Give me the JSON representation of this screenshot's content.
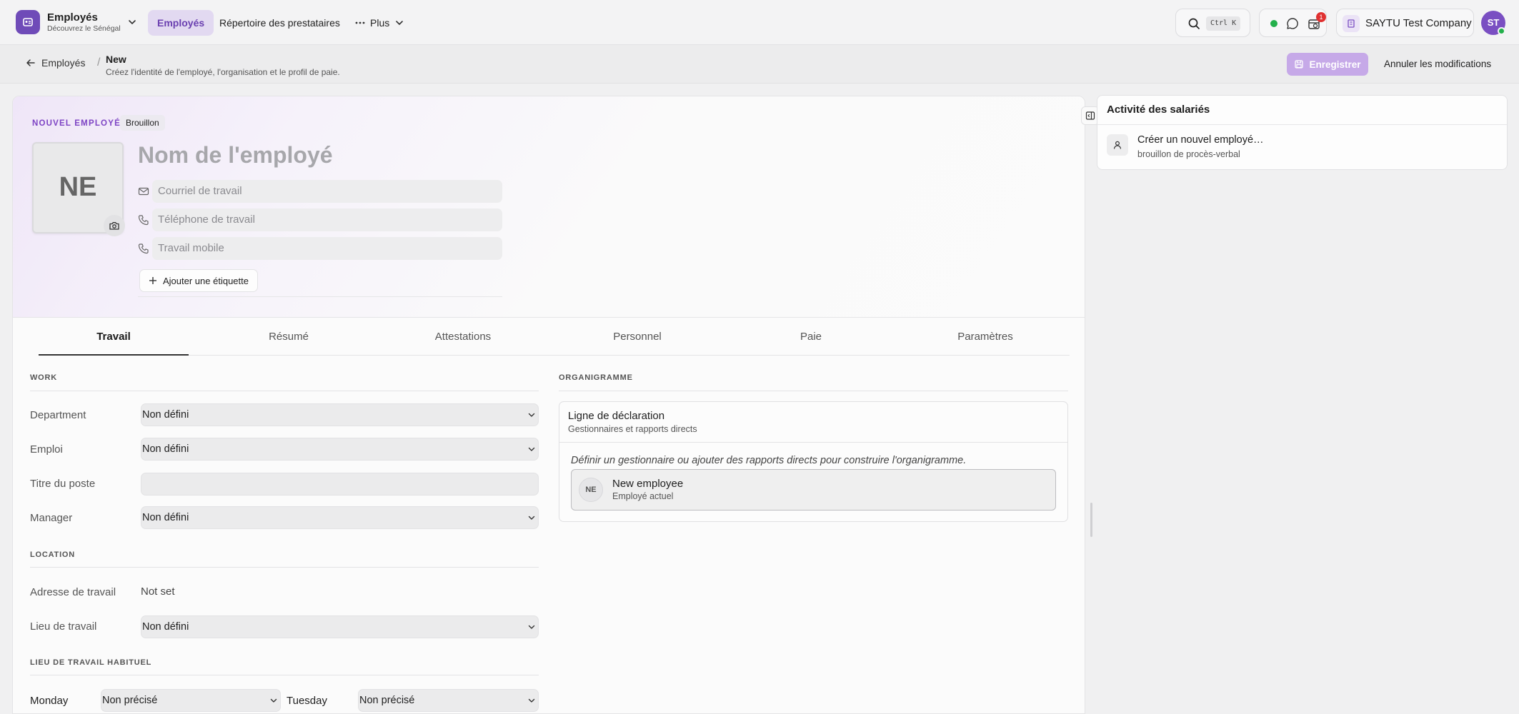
{
  "colors": {
    "accent": "#6f4bb8",
    "accent_light": "#e2d9f1",
    "online": "#23b04b",
    "alert": "#e03131",
    "save_button": "#c6a9e8"
  },
  "topbar": {
    "app_name": "Employés",
    "app_sub": "Découvrez le Sénégal",
    "nav": [
      "Employés",
      "Répertoire des prestataires",
      "Plus"
    ],
    "search_shortcut": "Ctrl K",
    "notification_count": "1",
    "company": "SAYTU Test Company",
    "avatar": "ST",
    "icons": [
      "app-icon",
      "chevron-down-icon",
      "more-icon",
      "search-icon",
      "chat-icon",
      "calendar-icon",
      "building-icon"
    ]
  },
  "subbar": {
    "back_label": "Employés",
    "title": "New",
    "subtitle": "Créez l'identité de l'employé, l'organisation et le profil de paie.",
    "save_label": "Enregistrer",
    "cancel_label": "Annuler les modifications"
  },
  "hero": {
    "section_label": "NOUVEL EMPLOYÉ",
    "status_badge": "Brouillon",
    "initials": "NE",
    "name_placeholder": "Nom de l'employé",
    "work_email_placeholder": "Courriel de travail",
    "work_phone_placeholder": "Téléphone de travail",
    "mobile_placeholder": "Travail mobile",
    "add_tag_label": "Ajouter une étiquette"
  },
  "tabs": [
    "Travail",
    "Résumé",
    "Attestations",
    "Personnel",
    "Paie",
    "Paramètres"
  ],
  "active_tab": "Travail",
  "work": {
    "heading": "WORK",
    "rows": [
      {
        "label": "Department",
        "value": "Non défini"
      },
      {
        "label": "Emploi",
        "value": "Non défini"
      },
      {
        "label": "Titre du poste",
        "value": ""
      },
      {
        "label": "Manager",
        "value": "Non défini"
      }
    ]
  },
  "location": {
    "heading": "LOCATION",
    "address_label": "Adresse de travail",
    "address_value": "Not set",
    "place_label": "Lieu de travail",
    "place_value": "Non défini"
  },
  "habitual": {
    "heading": "LIEU DE TRAVAIL HABITUEL",
    "days": [
      {
        "day": "Monday",
        "value": "Non précisé"
      },
      {
        "day": "Tuesday",
        "value": "Non précisé"
      }
    ]
  },
  "org": {
    "heading": "ORGANIGRAMME",
    "title": "Ligne de déclaration",
    "subtitle": "Gestionnaires et rapports directs",
    "hint": "Définir un gestionnaire ou ajouter des rapports directs pour construire l'organigramme.",
    "employee_initials": "NE",
    "employee_name": "New employee",
    "employee_role": "Employé actuel"
  },
  "activity": {
    "title": "Activité des salariés",
    "item_title": "Créer un nouvel employé…",
    "item_sub": "brouillon de procès-verbal"
  }
}
